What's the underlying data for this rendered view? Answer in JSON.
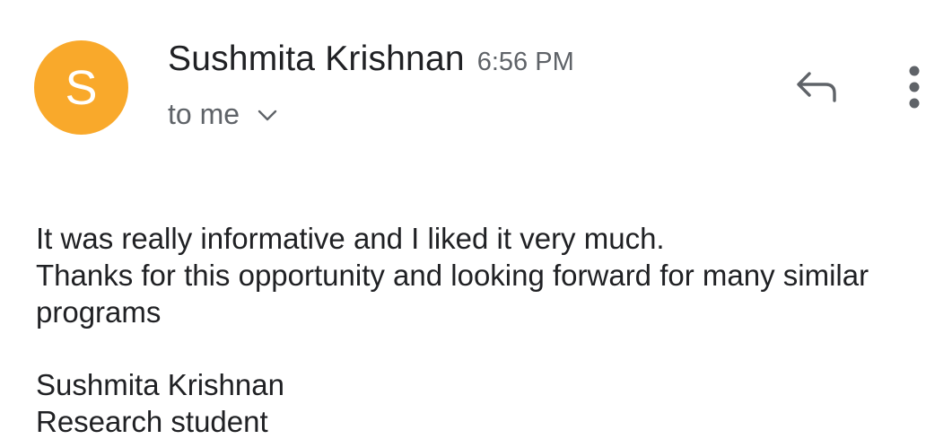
{
  "message": {
    "sender": {
      "name": "Sushmita Krishnan",
      "initial": "S",
      "avatar_color": "#F9A92B"
    },
    "time": "6:56 PM",
    "recipient_label": "to me",
    "actions": {
      "reply_icon": "reply-icon",
      "more_icon": "more-vertical-icon",
      "expand_icon": "chevron-down-icon"
    },
    "body": {
      "lines": [
        "It was really informative and I liked it very much.",
        "Thanks for this opportunity and looking forward for many similar programs"
      ],
      "signature": [
        "Sushmita Krishnan",
        "Research student"
      ]
    }
  }
}
